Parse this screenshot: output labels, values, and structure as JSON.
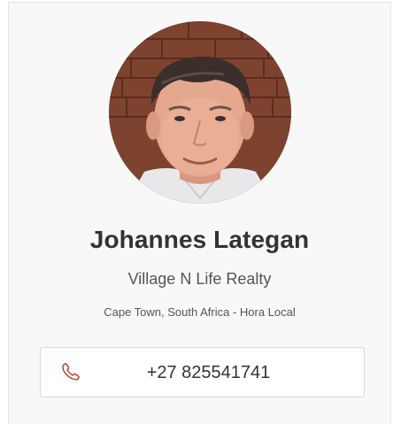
{
  "agent": {
    "name": "Johannes Lategan",
    "agency": "Village N Life Realty",
    "location": "Cape Town, South Africa - Hora Local",
    "phone": "+27 825541741"
  },
  "icons": {
    "phone": "phone-icon"
  },
  "colors": {
    "phone_icon": "#c0392b"
  }
}
